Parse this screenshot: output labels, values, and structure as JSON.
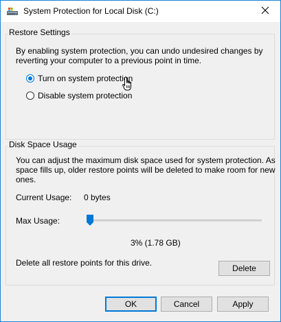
{
  "window": {
    "title": "System Protection for Local Disk (C:)"
  },
  "restore_settings": {
    "heading": "Restore Settings",
    "description_line1": "By enabling system protection, you can undo undesired changes by",
    "description_line2": "reverting your computer to a previous point in time.",
    "options": [
      {
        "label": "Turn on system protection",
        "checked": true
      },
      {
        "label": "Disable system protection",
        "checked": false
      }
    ]
  },
  "disk_space": {
    "heading": "Disk Space Usage",
    "description_line1": "You can adjust the maximum disk space used for system protection. As",
    "description_line2": "space fills up, older restore points will be deleted to make room for new",
    "description_line3": "ones.",
    "current_usage_label": "Current Usage:",
    "current_usage_value": "0 bytes",
    "max_usage_label": "Max Usage:",
    "max_usage_percent": 3,
    "max_usage_readout": "3% (1.78 GB)",
    "delete_text": "Delete all restore points for this drive.",
    "delete_button": "Delete"
  },
  "footer": {
    "ok": "OK",
    "cancel": "Cancel",
    "apply": "Apply"
  },
  "colors": {
    "accent": "#0078d7",
    "window_border": "#1883d7",
    "client_bg": "#f0f0f0"
  }
}
